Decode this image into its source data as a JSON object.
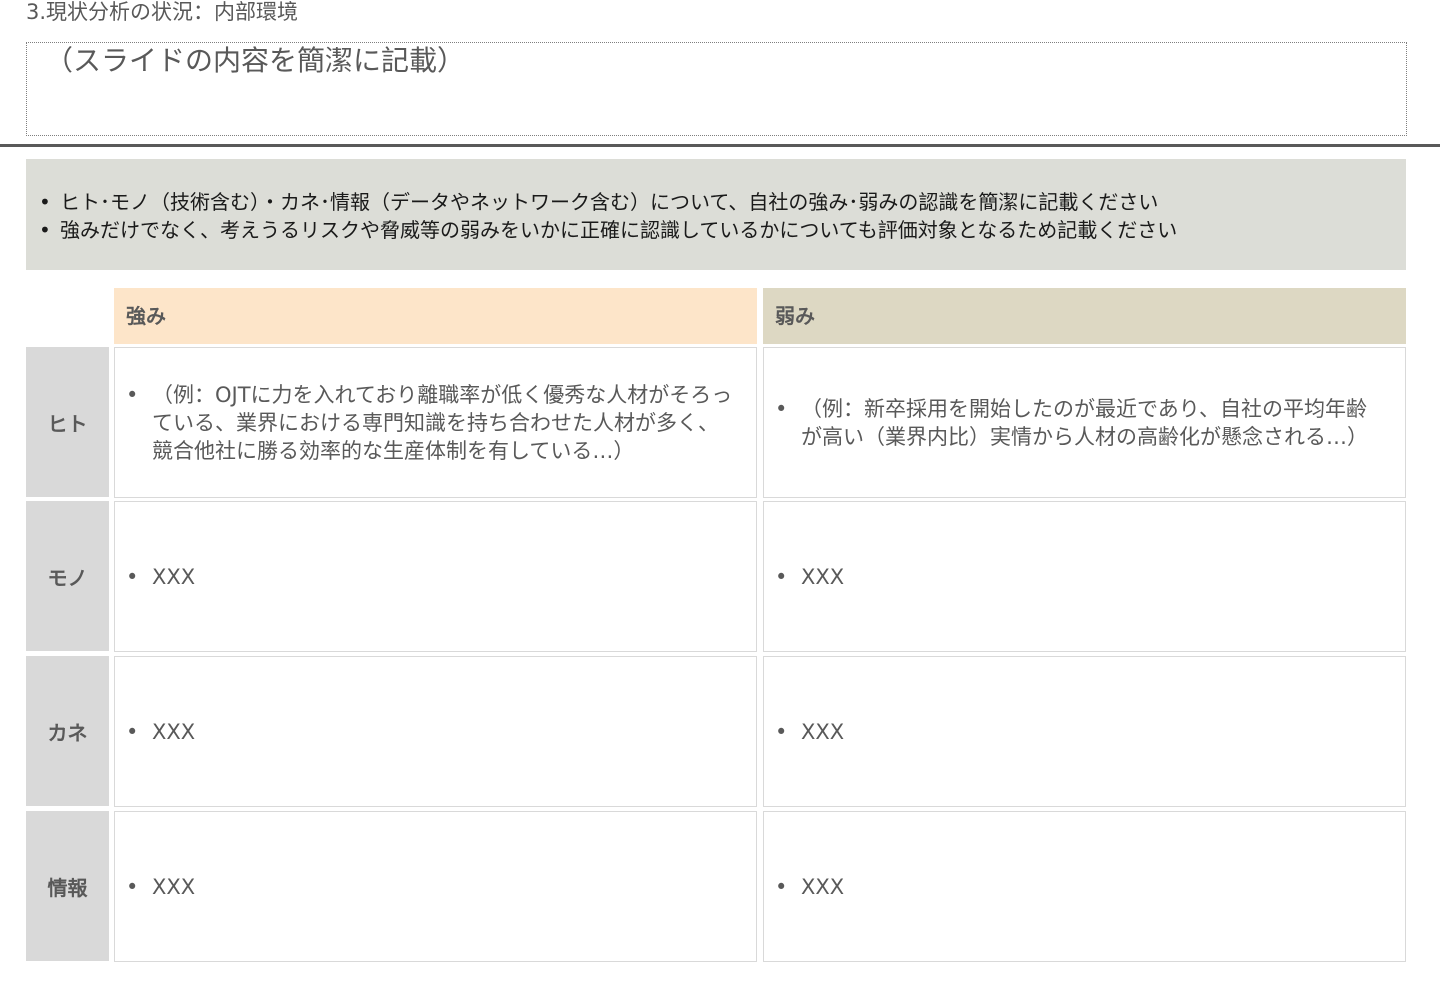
{
  "slide": {
    "section_title": "3.現状分析の状況：内部環境",
    "summary_placeholder": "（スライドの内容を簡潔に記載）"
  },
  "instructions": {
    "bullet": "•",
    "items": [
      "ヒト･モノ（技術含む）・カネ･情報（データやネットワーク含む）について、自社の強み･弱みの認識を簡潔に記載ください",
      "強みだけでなく、考えうるリスクや脅威等の弱みをいかに正確に認識しているかについても評価対象となるため記載ください"
    ]
  },
  "table": {
    "columns": {
      "strength": "強み",
      "weakness": "弱み"
    },
    "bullet": "•",
    "rows": [
      {
        "label": "ヒト",
        "strength": "（例：OJTに力を入れており離職率が低く優秀な人材がそろっている、業界における専門知識を持ち合わせた人材が多く、競合他社に勝る効率的な生産体制を有している…）",
        "weakness": "（例：新卒採用を開始したのが最近であり、自社の平均年齢が高い（業界内比）実情から人材の高齢化が懸念される…）"
      },
      {
        "label": "モノ",
        "strength": "XXX",
        "weakness": "XXX"
      },
      {
        "label": "カネ",
        "strength": "XXX",
        "weakness": "XXX"
      },
      {
        "label": "情報",
        "strength": "XXX",
        "weakness": "XXX"
      }
    ]
  }
}
